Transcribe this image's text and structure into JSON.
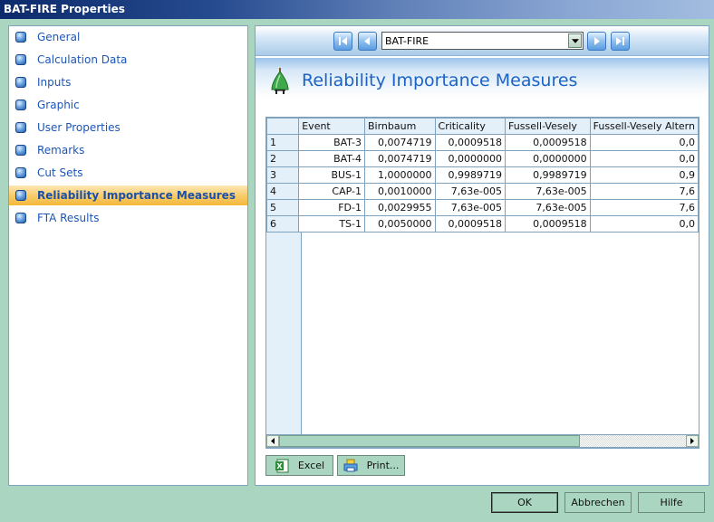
{
  "window": {
    "title": "BAT-FIRE Properties"
  },
  "sidebar": {
    "active_index": 7,
    "items": [
      {
        "label": "General"
      },
      {
        "label": "Calculation Data"
      },
      {
        "label": "Inputs"
      },
      {
        "label": "Graphic"
      },
      {
        "label": "User Properties"
      },
      {
        "label": "Remarks"
      },
      {
        "label": "Cut Sets"
      },
      {
        "label": "Reliability Importance Measures"
      },
      {
        "label": "FTA Results"
      }
    ]
  },
  "toolbar": {
    "selected_object": "BAT-FIRE",
    "first_icon": "first-record-icon",
    "prev_icon": "previous-record-icon",
    "next_icon": "next-record-icon",
    "last_icon": "last-record-icon"
  },
  "panel": {
    "title": "Reliability Importance Measures",
    "icon": "fault-tree-icon"
  },
  "grid": {
    "columns": [
      "Event",
      "Birnbaum",
      "Criticality",
      "Fussell-Vesely",
      "Fussell-Vesely Altern"
    ],
    "rows": [
      {
        "num": "1",
        "cells": [
          "BAT-3",
          "0,0074719",
          "0,0009518",
          "0,0009518",
          "0,0"
        ]
      },
      {
        "num": "2",
        "cells": [
          "BAT-4",
          "0,0074719",
          "0,0000000",
          "0,0000000",
          "0,0"
        ]
      },
      {
        "num": "3",
        "cells": [
          "BUS-1",
          "1,0000000",
          "0,9989719",
          "0,9989719",
          "0,9"
        ]
      },
      {
        "num": "4",
        "cells": [
          "CAP-1",
          "0,0010000",
          "7,63e-005",
          "7,63e-005",
          "7,6"
        ]
      },
      {
        "num": "5",
        "cells": [
          "FD-1",
          "0,0029955",
          "7,63e-005",
          "7,63e-005",
          "7,6"
        ]
      },
      {
        "num": "6",
        "cells": [
          "TS-1",
          "0,0050000",
          "0,0009518",
          "0,0009518",
          "0,0"
        ]
      }
    ],
    "scroll_position": 0.74
  },
  "actions": {
    "excel_label": "Excel",
    "print_label": "Print..."
  },
  "footer": {
    "ok_label": "OK",
    "cancel_label": "Abbrechen",
    "help_label": "Hilfe"
  }
}
